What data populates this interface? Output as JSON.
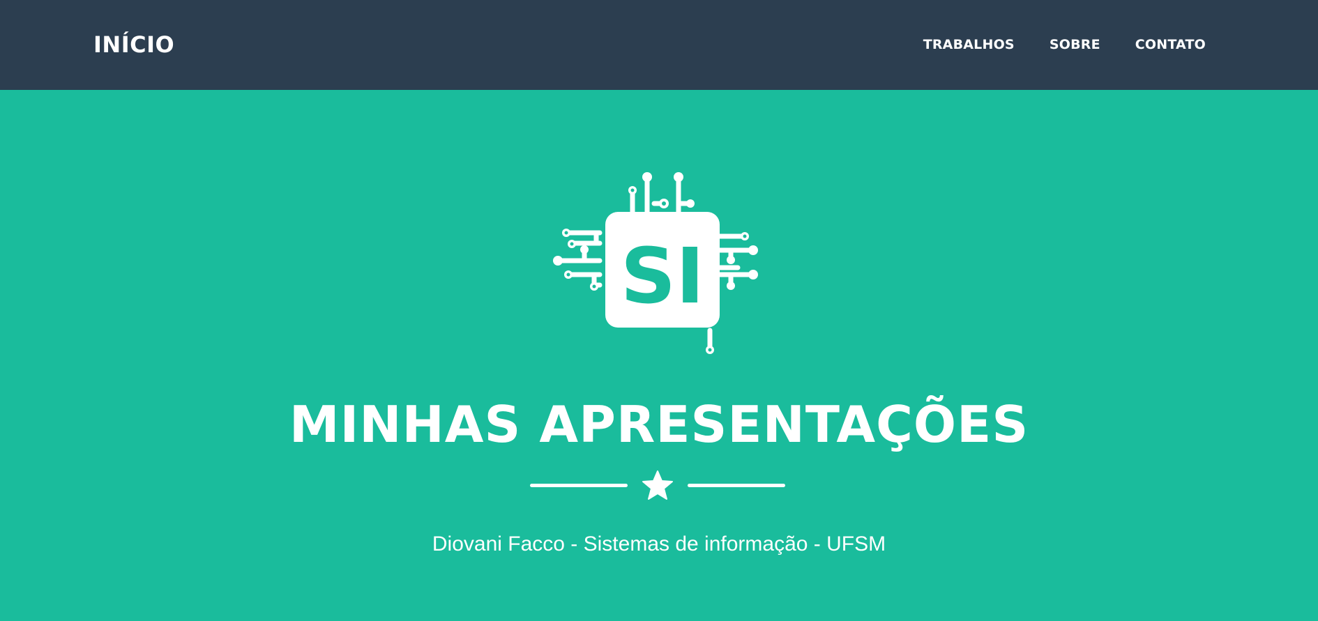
{
  "navbar": {
    "brand": "INÍCIO",
    "links": [
      "TRABALHOS",
      "SOBRE",
      "CONTATO"
    ]
  },
  "hero": {
    "logo_text": "SI",
    "title": "MINHAS APRESENTAÇÕES",
    "subtitle": "Diovani Facco - Sistemas de informação - UFSM"
  },
  "colors": {
    "navbar_bg": "#2c3e50",
    "hero_bg": "#1abc9c",
    "text": "#ffffff"
  },
  "icons": {
    "logo": "circuit-chip-icon",
    "divider": "star-icon"
  }
}
